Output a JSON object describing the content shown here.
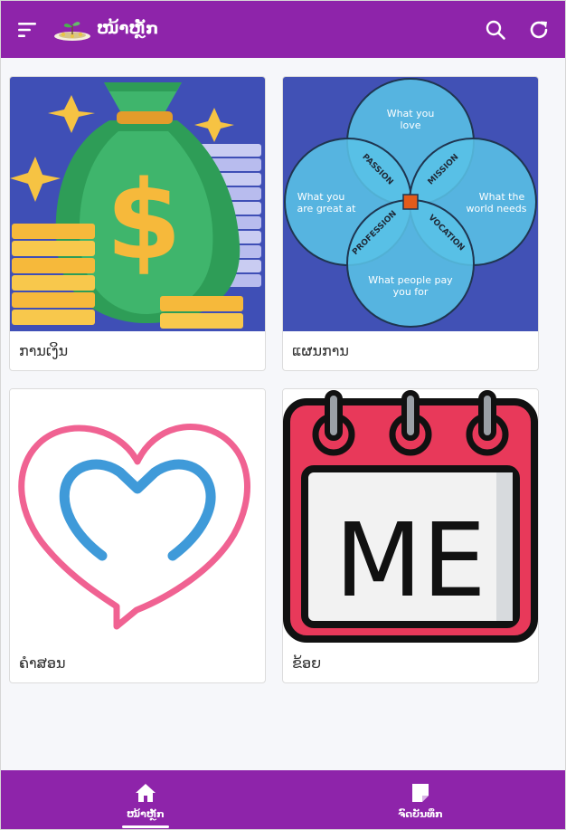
{
  "header": {
    "title": "ໜ້າຫຼັກ",
    "menu_icon": "menu-icon",
    "logo_icon": "money-plant-logo",
    "search_icon": "search-icon",
    "refresh_icon": "refresh-icon"
  },
  "cards": [
    {
      "label": "ການເງິນ",
      "image": "money-bag-illustration"
    },
    {
      "label": "ແຜນການ",
      "image": "ikigai-venn-diagram",
      "diagram_text": {
        "love": [
          "What you",
          "love"
        ],
        "great": [
          "What you",
          "are great at"
        ],
        "world": [
          "What the",
          "world needs"
        ],
        "paid": [
          "What people pay",
          "you for"
        ],
        "passion": "PASSION",
        "mission": "MISSION",
        "profession": "PROFESSION",
        "vocation": "VOCATION"
      }
    },
    {
      "label": "ຄຳສອນ",
      "image": "heart-illustration"
    },
    {
      "label": "ຂ້ອຍ",
      "image": "calendar-me-illustration",
      "calendar_text": "ME"
    }
  ],
  "bottom_nav": {
    "tabs": [
      {
        "label": "ໜ້າຫຼັກ",
        "icon": "home-icon",
        "active": true
      },
      {
        "label": "ຈົດບັນທຶກ",
        "icon": "note-icon",
        "active": false
      }
    ]
  },
  "colors": {
    "primary": "#8e24aa",
    "background": "#f6f7fa"
  }
}
